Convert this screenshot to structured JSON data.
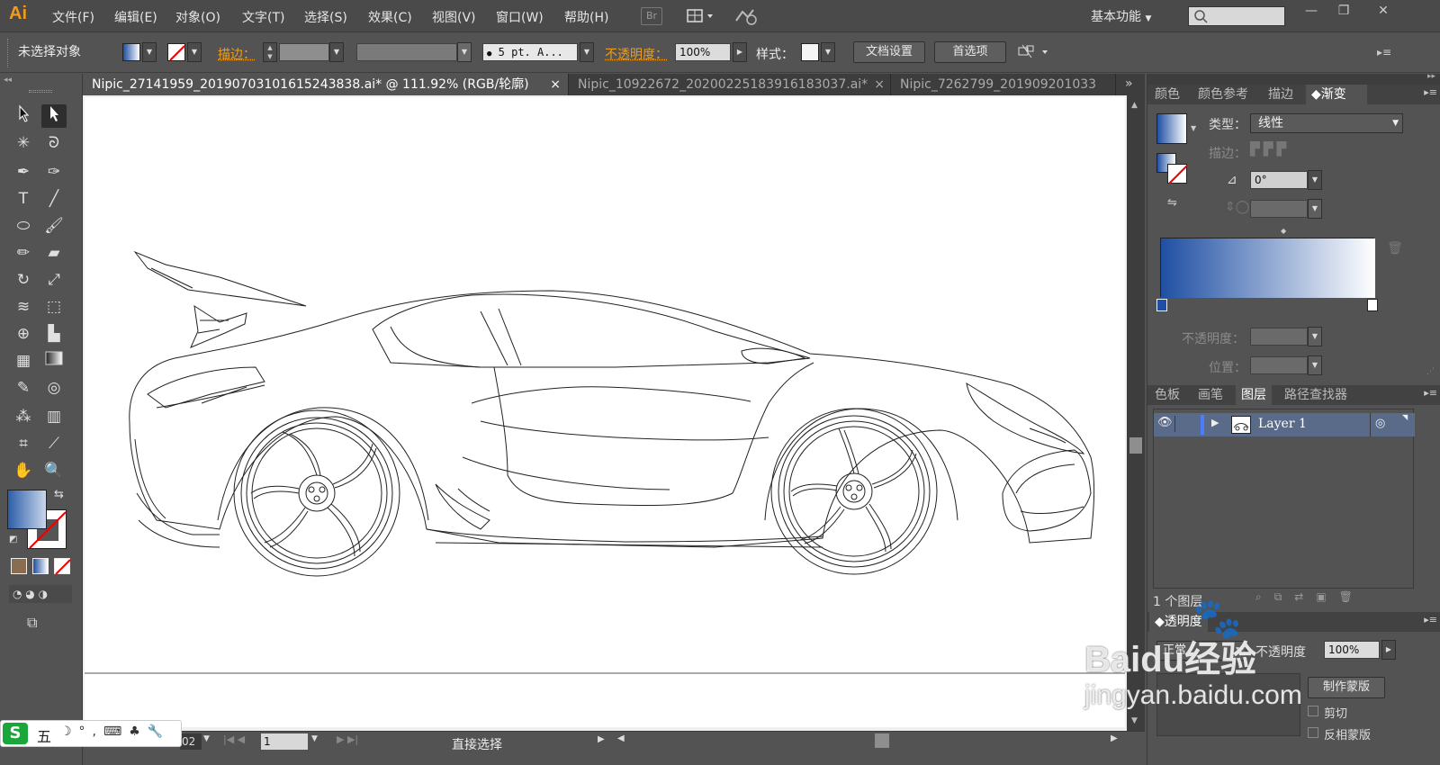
{
  "app": {
    "logo": "Ai"
  },
  "menu": {
    "items": [
      "文件(F)",
      "编辑(E)",
      "对象(O)",
      "文字(T)",
      "选择(S)",
      "效果(C)",
      "视图(V)",
      "窗口(W)",
      "帮助(H)"
    ],
    "br": "Br",
    "workspace": "基本功能"
  },
  "control": {
    "selection": "未选择对象",
    "stroke_label": "描边：",
    "brush": "5 pt. A...",
    "opacity_label": "不透明度：",
    "opacity": "100%",
    "style_label": "样式：",
    "doc_setup": "文档设置",
    "prefs": "首选项"
  },
  "tabs": [
    {
      "label": "Nipic_27141959_20190703101615243838.ai* @ 111.92% (RGB/轮廓)",
      "close": "×"
    },
    {
      "label": "Nipic_10922672_20200225183916183037.ai*",
      "close": "×"
    },
    {
      "label": "Nipic_7262799_201909201033"
    }
  ],
  "tabs_more": "»",
  "status": {
    "zoom": "02",
    "artboard": "1",
    "tool": "直接选择"
  },
  "gradient_panel": {
    "tabs": [
      "颜色",
      "颜色参考",
      "描边",
      "渐变"
    ],
    "type_label": "类型：",
    "type_value": "线性",
    "stroke_label": "描边：",
    "angle": "0°",
    "opacity_label": "不透明度：",
    "location_label": "位置：",
    "colors": {
      "start": "#1f4fa3",
      "end": "#ffffff"
    }
  },
  "layers_panel": {
    "tabs": [
      "色板",
      "画笔",
      "图层",
      "路径查找器"
    ],
    "layers": [
      {
        "name": "Layer 1"
      }
    ],
    "count": "1 个图层"
  },
  "transparency_panel": {
    "title": "透明度",
    "mode": "正常",
    "opacity_label": "不透明度",
    "opacity": "100%",
    "make_mask": "制作蒙版",
    "clip": "剪切",
    "invert": "反相蒙版"
  },
  "ime": {
    "label": "五"
  },
  "watermark": {
    "brand": "Baidu经验",
    "url": "jingyan.baidu.com"
  },
  "colors": {
    "accent": "#f39c12",
    "ui_bg": "#535353",
    "dark_bg": "#3d3d3d",
    "highlight": "#5a6b8a"
  }
}
